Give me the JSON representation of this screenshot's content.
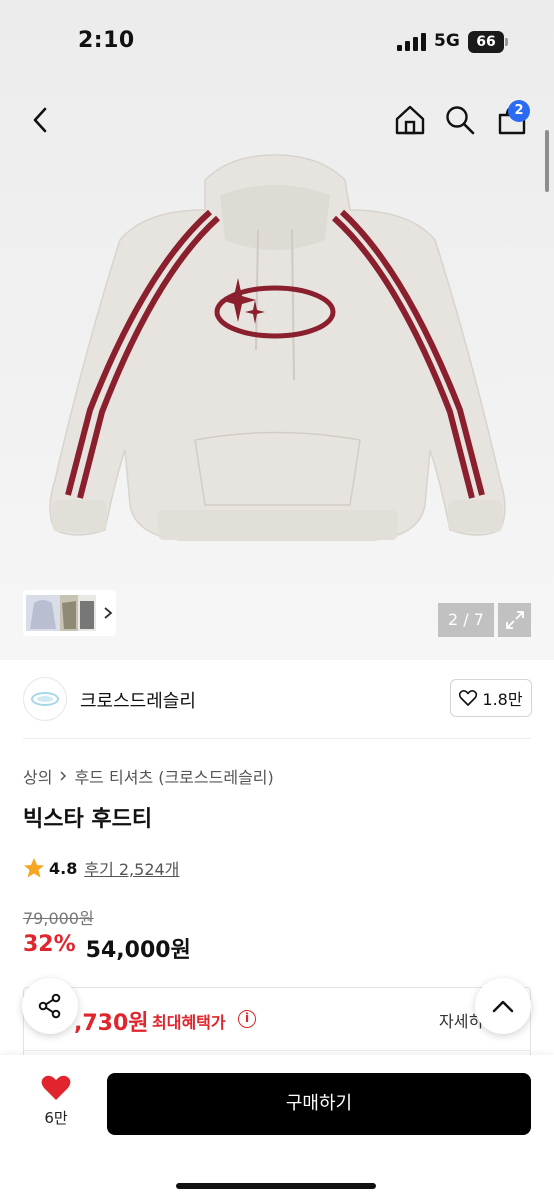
{
  "status_bar": {
    "time": "2:10",
    "network": "5G",
    "battery": "66"
  },
  "nav": {
    "cart_count": "2"
  },
  "gallery": {
    "counter": "2 / 7"
  },
  "brand": {
    "name": "크로스드레슬리",
    "likes": "1.8만"
  },
  "breadcrumb": {
    "category": "상의",
    "subcategory": "후드 티셔츠 (크로스드레슬리)"
  },
  "product": {
    "title": "빅스타 후드티",
    "rating": "4.8",
    "reviews": "후기 2,524개",
    "original_price": "79,000원",
    "discount": "32%",
    "sale_price": "54,000원"
  },
  "benefit": {
    "price": ",730원",
    "label": "최대혜택가",
    "detail_link": "자세히"
  },
  "bottom_bar": {
    "wish_count": "6만",
    "buy_label": "구매하기"
  },
  "colors": {
    "accent_red": "#e0252d",
    "badge_blue": "#2b6bf3",
    "buy_button": "#000000",
    "stripe": "#8a1f2e"
  },
  "icons": [
    "back-icon",
    "home-icon",
    "search-icon",
    "cart-icon",
    "chevron-right-icon",
    "expand-icon",
    "heart-outline-icon",
    "star-icon",
    "info-icon",
    "share-icon",
    "chevron-up-icon",
    "heart-filled-icon"
  ]
}
